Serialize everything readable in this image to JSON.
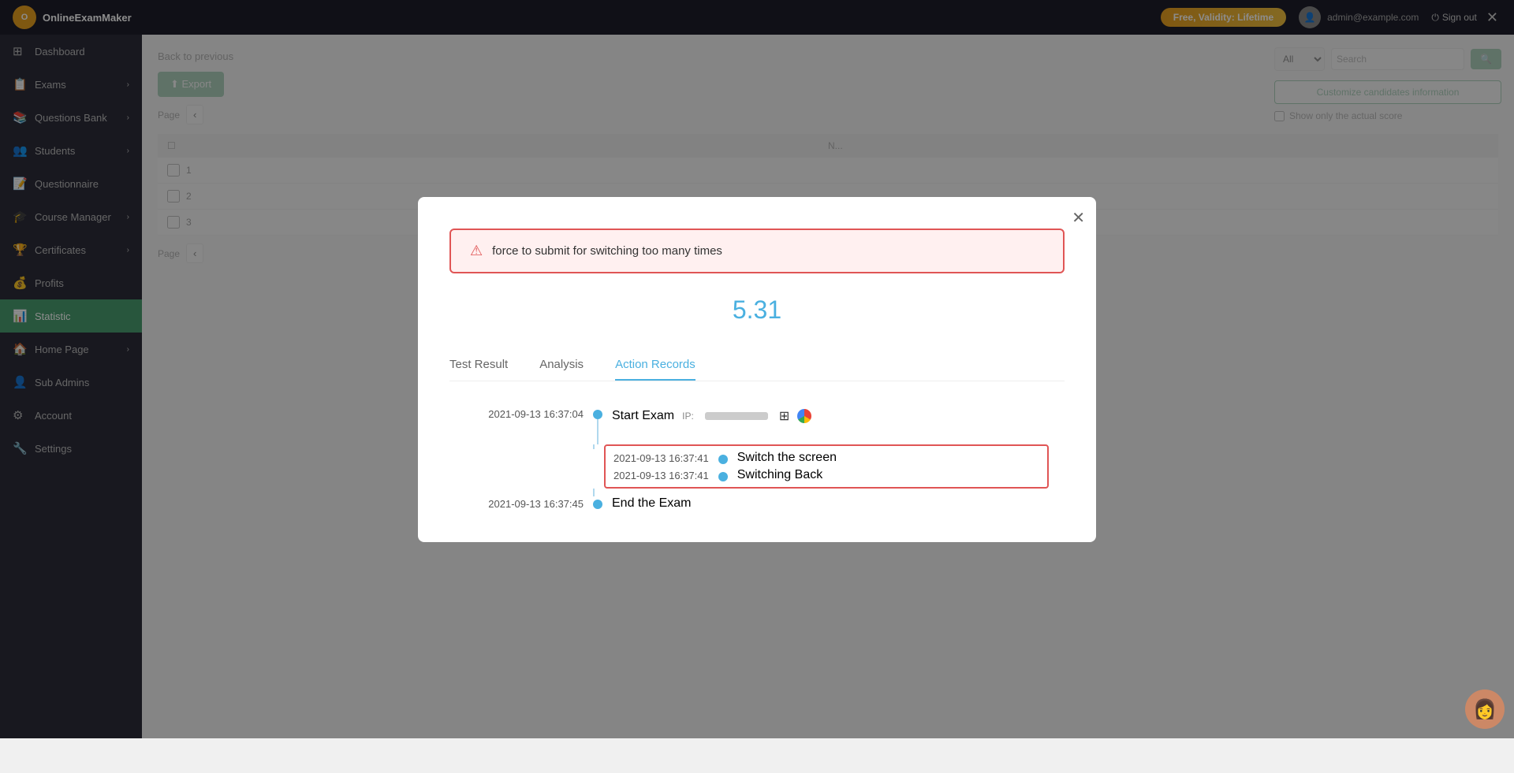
{
  "app": {
    "name": "OnlineExamMaker",
    "plan": "Free, Validity: Lifetime",
    "sign_out": "Sign out"
  },
  "sidebar": {
    "items": [
      {
        "id": "dashboard",
        "label": "Dashboard",
        "icon": "⊞",
        "arrow": ""
      },
      {
        "id": "exams",
        "label": "Exams",
        "icon": "📋",
        "arrow": "›"
      },
      {
        "id": "questions-bank",
        "label": "Questions Bank",
        "icon": "📚",
        "arrow": "›"
      },
      {
        "id": "students",
        "label": "Students",
        "icon": "👥",
        "arrow": "›"
      },
      {
        "id": "questionnaire",
        "label": "Questionnaire",
        "icon": "📝",
        "arrow": ""
      },
      {
        "id": "course-manager",
        "label": "Course Manager",
        "icon": "🎓",
        "arrow": "›"
      },
      {
        "id": "certificates",
        "label": "Certificates",
        "icon": "🏆",
        "arrow": "›"
      },
      {
        "id": "profits",
        "label": "Profits",
        "icon": "💰",
        "arrow": ""
      },
      {
        "id": "statistic",
        "label": "Statistic",
        "icon": "📊",
        "arrow": ""
      },
      {
        "id": "home-page",
        "label": "Home Page",
        "icon": "🏠",
        "arrow": "›"
      },
      {
        "id": "sub-admins",
        "label": "Sub Admins",
        "icon": "👤",
        "arrow": ""
      },
      {
        "id": "account",
        "label": "Account",
        "icon": "⚙",
        "arrow": ""
      },
      {
        "id": "settings",
        "label": "Settings",
        "icon": "🔧",
        "arrow": ""
      }
    ]
  },
  "topbar": {
    "plan_label": "Free, Validity: Lifetime",
    "username": "admin@example.com",
    "sign_out_label": "Sign out"
  },
  "breadcrumb": "Back to previous",
  "export_label": "Export",
  "right": {
    "search_placeholder": "Search",
    "customize_label": "Customize candidates information",
    "show_score_label": "Show only the actual score"
  },
  "modal": {
    "alert_message": "force to submit for switching too many times",
    "score": "5.31",
    "tabs": [
      {
        "id": "test-result",
        "label": "Test Result"
      },
      {
        "id": "analysis",
        "label": "Analysis"
      },
      {
        "id": "action-records",
        "label": "Action Records"
      }
    ],
    "active_tab": "action-records",
    "timeline": [
      {
        "time": "2021-09-13 16:37:04",
        "dot_color": "#4ab0e0",
        "event": "Start Exam",
        "extra": "IP:",
        "ip_blurred": true,
        "has_os": true,
        "has_browser": true,
        "highlighted": false
      },
      {
        "time": "2021-09-13 16:37:41",
        "dot_color": "#4ab0e0",
        "event": "Switch the screen",
        "highlighted": true
      },
      {
        "time": "2021-09-13 16:37:41",
        "dot_color": "#4ab0e0",
        "event": "Switching Back",
        "highlighted": true
      },
      {
        "time": "2021-09-13 16:37:45",
        "dot_color": "#4ab0e0",
        "event": "End the Exam",
        "highlighted": false
      }
    ]
  },
  "page": {
    "label": "Page"
  }
}
